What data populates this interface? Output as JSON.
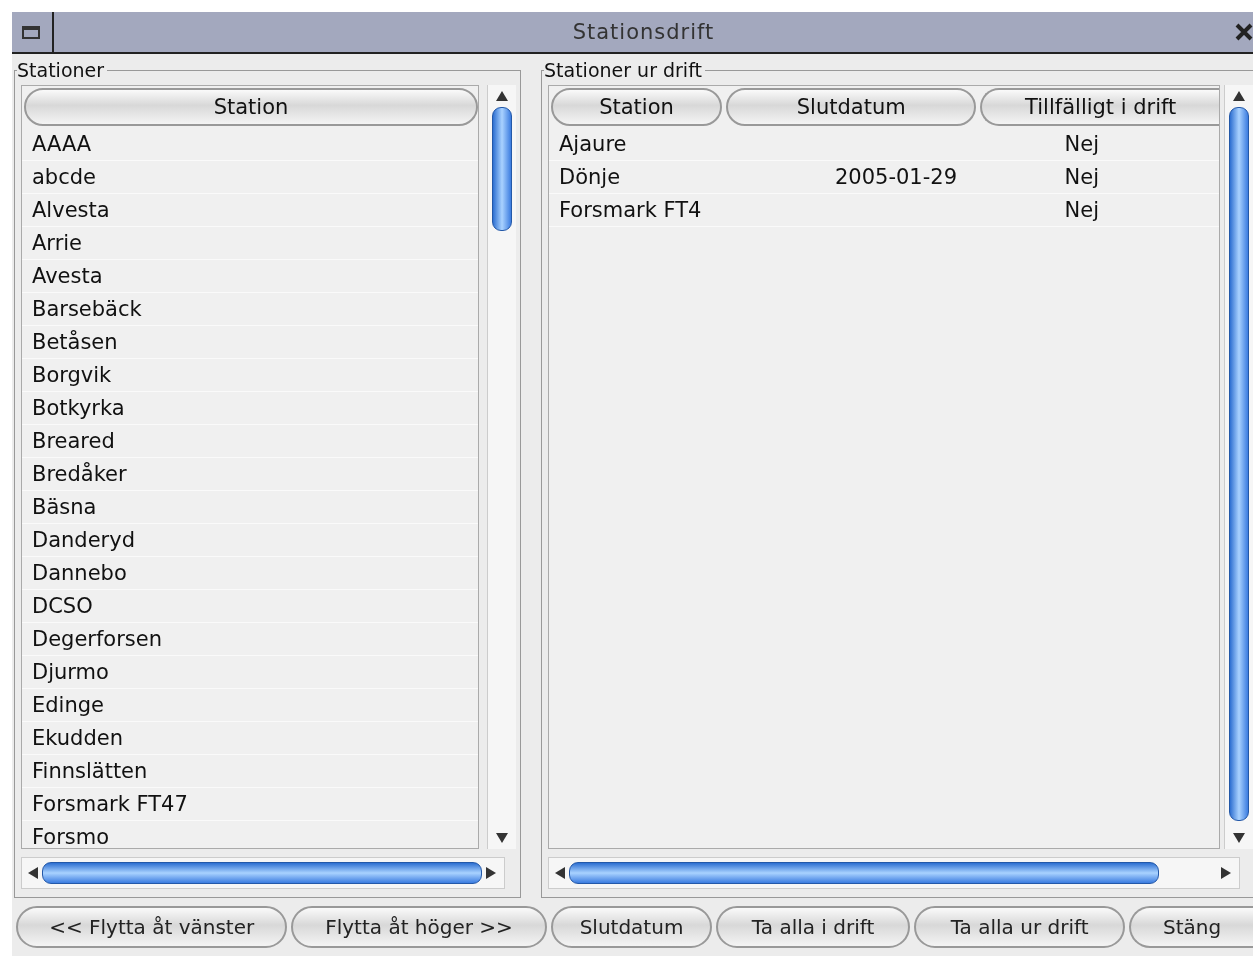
{
  "window": {
    "title": "Stationsdrift"
  },
  "stations_panel": {
    "title": "Stationer",
    "columns": [
      "Station"
    ],
    "rows": [
      "AAAA",
      "abcde",
      "Alvesta",
      "Arrie",
      "Avesta",
      "Barsebäck",
      "Betåsen",
      "Borgvik",
      "Botkyrka",
      "Breared",
      "Bredåker",
      "Bäsna",
      "Danderyd",
      "Dannebo",
      "DCSO",
      "Degerforsen",
      "Djurmo",
      "Edinge",
      "Ekudden",
      "Finnslätten",
      "Forsmark FT47",
      "Forsmo"
    ]
  },
  "out_of_service_panel": {
    "title": "Stationer ur drift",
    "columns": [
      "Station",
      "Slutdatum",
      "Tillfälligt i drift"
    ],
    "rows": [
      {
        "station": "Ajaure",
        "end_date": "",
        "temporary": "Nej"
      },
      {
        "station": "Dönje",
        "end_date": "2005-01-29",
        "temporary": "Nej"
      },
      {
        "station": "Forsmark FT4",
        "end_date": "",
        "temporary": "Nej"
      }
    ]
  },
  "buttons": [
    "<< Flytta åt vänster",
    "Flytta åt höger >>",
    "Slutdatum",
    "Ta alla i drift",
    "Ta alla ur drift",
    "Stäng"
  ]
}
